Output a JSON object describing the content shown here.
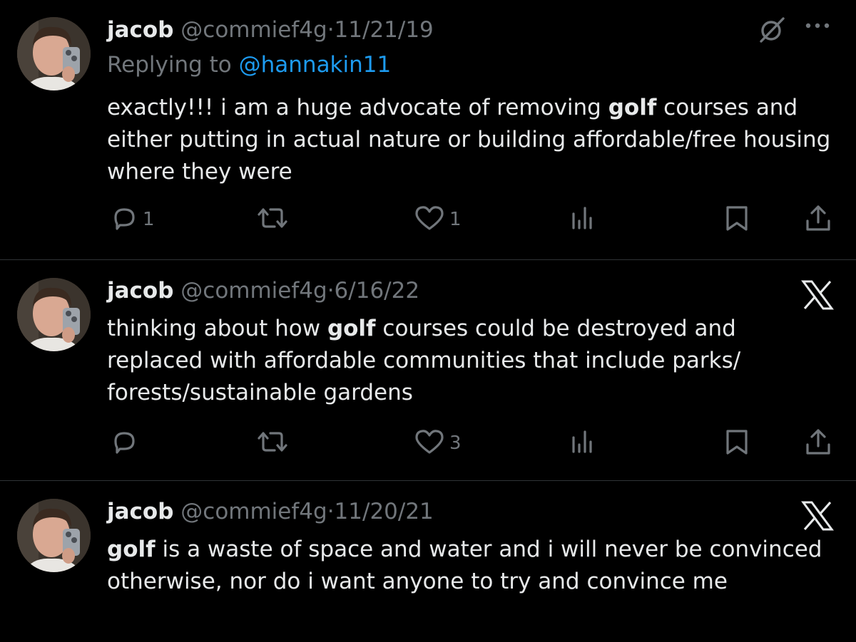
{
  "tweets": [
    {
      "name": "jacob",
      "handle": "@commief4g",
      "separator": "·",
      "date": "11/21/19",
      "replying_prefix": "Replying to ",
      "replying_mention": "@hannakin11",
      "text_before": "exactly!!! i am a huge advocate of removing ",
      "keyword": "golf",
      "text_after": " courses and either putting in actual nature or building affordable/free housing where they were",
      "replies": "1",
      "retweets": "",
      "likes": "1",
      "top_icons": [
        "grok-icon",
        "more-icon"
      ],
      "action_icons": [
        "reply-icon",
        "retweet-icon",
        "like-icon",
        "views-icon",
        "bookmark-icon",
        "share-icon"
      ]
    },
    {
      "name": "jacob",
      "handle": "@commief4g",
      "separator": "·",
      "date": "6/16/22",
      "text_before": "thinking about how ",
      "keyword": "golf",
      "text_after": " courses could be destroyed and replaced with affordable communities that include parks/ forests/sustainable gardens",
      "replies": "",
      "retweets": "",
      "likes": "3",
      "top_icons": [
        "x-logo-icon"
      ],
      "action_icons": [
        "reply-icon",
        "retweet-icon",
        "like-icon",
        "views-icon",
        "bookmark-icon",
        "share-icon"
      ]
    },
    {
      "name": "jacob",
      "handle": "@commief4g",
      "separator": "·",
      "date": "11/20/21",
      "text_before": "",
      "keyword": "golf",
      "text_after": " is a waste of space and water and i will never be convinced otherwise, nor do i want anyone to try and convince me",
      "top_icons": [
        "x-logo-icon"
      ]
    }
  ],
  "colors": {
    "background": "#000000",
    "text": "#e7e9ea",
    "secondary": "#71767b",
    "link": "#1d9bf0",
    "divider": "#2f3336"
  }
}
